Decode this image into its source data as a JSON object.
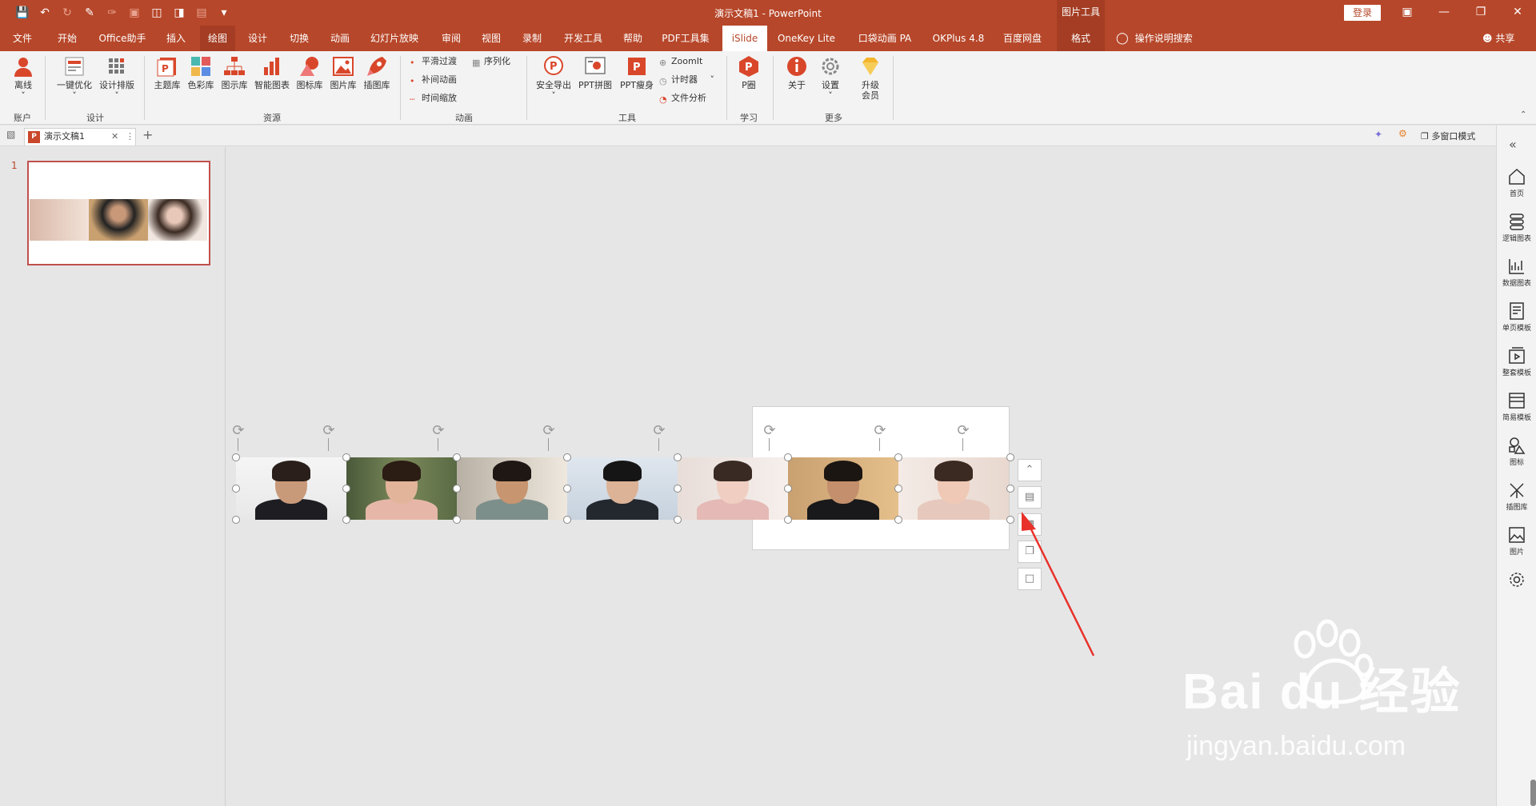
{
  "titlebar": {
    "doc_title": "演示文稿1  -  PowerPoint",
    "picture_tools": "图片工具",
    "login": "登录"
  },
  "tabs": [
    {
      "label": "文件"
    },
    {
      "label": "开始"
    },
    {
      "label": "Office助手"
    },
    {
      "label": "插入"
    },
    {
      "label": "绘图"
    },
    {
      "label": "设计"
    },
    {
      "label": "切换"
    },
    {
      "label": "动画"
    },
    {
      "label": "幻灯片放映"
    },
    {
      "label": "审阅"
    },
    {
      "label": "视图"
    },
    {
      "label": "录制"
    },
    {
      "label": "开发工具"
    },
    {
      "label": "帮助"
    },
    {
      "label": "PDF工具集"
    },
    {
      "label": "iSlide"
    },
    {
      "label": "OneKey Lite"
    },
    {
      "label": "口袋动画 PA"
    },
    {
      "label": "OKPlus 4.8"
    },
    {
      "label": "百度网盘"
    },
    {
      "label": "格式"
    }
  ],
  "search_tab": "操作说明搜索",
  "share": "共享",
  "ribbon": {
    "account": {
      "offline": "离线",
      "group": "账户"
    },
    "design": {
      "optimize": "一键优化",
      "layout": "设计排版",
      "group": "设计"
    },
    "resources": {
      "theme": "主题库",
      "color": "色彩库",
      "diagram": "图示库",
      "smartchart": "智能图表",
      "icon": "图标库",
      "picture": "图片库",
      "illustration": "插图库",
      "group": "资源"
    },
    "animation": {
      "smooth": "平滑过渡",
      "sequence": "序列化",
      "tween": "补间动画",
      "timescale": "时间缩放",
      "group": "动画"
    },
    "tools": {
      "export": "安全导出",
      "collage": "PPT拼图",
      "slim": "PPT瘦身",
      "zoomit": "ZoomIt",
      "timer": "计时器",
      "analysis": "文件分析",
      "group": "工具"
    },
    "learn": {
      "p": "P圈",
      "group": "学习"
    },
    "more": {
      "about": "关于",
      "settings": "设置",
      "upgrade": "升级会员",
      "group": "更多"
    }
  },
  "docbar": {
    "tab_label": "演示文稿1",
    "multiwin": "多窗口模式"
  },
  "slide_panel": {
    "number": "1"
  },
  "sidebar": {
    "items": [
      {
        "label": "首页"
      },
      {
        "label": "逻辑图表"
      },
      {
        "label": "数据图表"
      },
      {
        "label": "单页模板"
      },
      {
        "label": "整套模板"
      },
      {
        "label": "简易模板"
      },
      {
        "label": "图标"
      },
      {
        "label": "插图库"
      },
      {
        "label": "图片"
      }
    ]
  },
  "watermark": {
    "brand": "Bai du 经验",
    "url": "jingyan.baidu.com"
  },
  "colors": {
    "accent": "#b7472a",
    "ribbon_bg": "#f3f3f3",
    "canvas_bg": "#e6e6e6",
    "arrow": "#e8312a"
  }
}
